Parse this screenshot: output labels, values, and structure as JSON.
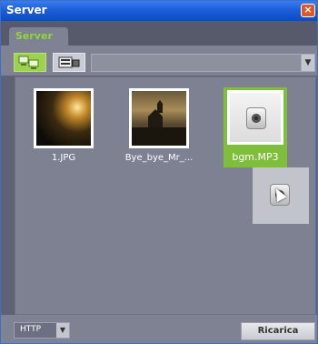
{
  "window": {
    "title": "Server",
    "close_glyph": "×"
  },
  "tabs": [
    {
      "label": "Server",
      "active": true
    }
  ],
  "toolbar": {
    "buttons": [
      {
        "icon": "computers-network-icon",
        "active": true
      },
      {
        "icon": "server-connect-icon",
        "active": false
      }
    ],
    "path_combo": {
      "value": ""
    }
  },
  "files": [
    {
      "name": "1.JPG",
      "type": "image"
    },
    {
      "name": "Bye_bye_Mr_...",
      "type": "image"
    },
    {
      "name": "bgm.MP3",
      "type": "audio",
      "selected": true
    }
  ],
  "statusbar": {
    "protocol": "HTTP",
    "reload_label": "Ricarica"
  },
  "colors": {
    "accent": "#8fd63a",
    "selection": "#7fbe3a",
    "titlebar": "#1d5fd8",
    "panel": "#7d8192"
  }
}
